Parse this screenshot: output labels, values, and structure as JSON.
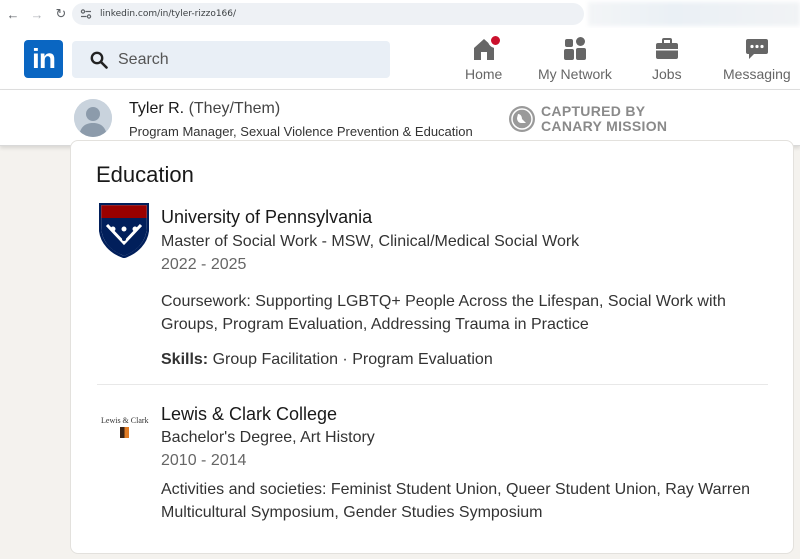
{
  "browser": {
    "url": "linkedin.com/in/tyler-rizzo166/"
  },
  "header": {
    "logo_text": "in",
    "search_placeholder": "Search",
    "nav": {
      "home": "Home",
      "network": "My Network",
      "jobs": "Jobs",
      "messaging": "Messaging"
    }
  },
  "profile": {
    "name": "Tyler R.",
    "pronouns": "(They/Them)",
    "headline": "Program Manager, Sexual Violence Prevention & Education",
    "captured_line1": "CAPTURED BY",
    "captured_line2": "CANARY MISSION"
  },
  "education": {
    "title": "Education",
    "entries": [
      {
        "school": "University of Pennsylvania",
        "degree": "Master of Social Work - MSW, Clinical/Medical Social Work",
        "years": "2022 - 2025",
        "description": "Coursework: Supporting LGBTQ+ People Across the Lifespan, Social Work with Groups, Program Evaluation, Addressing Trauma in Practice",
        "skills_label": "Skills:",
        "skills": "Group Facilitation · Program Evaluation"
      },
      {
        "school": "Lewis & Clark College",
        "logo_text": "Lewis & Clark",
        "degree": "Bachelor's Degree, Art History",
        "years": "2010 - 2014",
        "description": "Activities and societies: Feminist Student Union, Queer Student Union, Ray Warren Multicultural Symposium, Gender Studies Symposium"
      }
    ]
  },
  "colors": {
    "brand": "#0a66c2",
    "badge": "#cb112d",
    "penn_red": "#990000",
    "penn_blue": "#011f5b"
  }
}
